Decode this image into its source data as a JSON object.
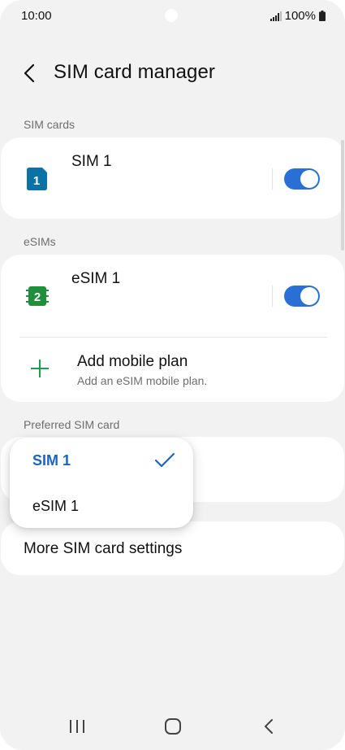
{
  "status_bar": {
    "time": "10:00",
    "battery": "100%"
  },
  "header": {
    "title": "SIM card manager",
    "back_icon": "chevron-left-icon"
  },
  "sim_cards": {
    "section_label": "SIM cards",
    "items": [
      {
        "label": "SIM 1",
        "icon": "sim-1-icon",
        "icon_number": "1",
        "icon_color": "#0b72a8",
        "enabled": true
      }
    ]
  },
  "esims": {
    "section_label": "eSIMs",
    "items": [
      {
        "label": "eSIM 1",
        "icon": "esim-2-icon",
        "icon_number": "2",
        "icon_color": "#1e8f3a",
        "enabled": true
      }
    ],
    "add_plan": {
      "title": "Add mobile plan",
      "subtitle": "Add an eSIM mobile plan."
    }
  },
  "preferred": {
    "section_label": "Preferred SIM card",
    "dropdown": {
      "options": [
        {
          "label": "SIM 1",
          "selected": true
        },
        {
          "label": "eSIM 1",
          "selected": false
        }
      ]
    }
  },
  "more": {
    "label": "More SIM card settings"
  },
  "colors": {
    "accent": "#2a6fd6",
    "selected_text": "#1a64c8",
    "background": "#f2f2f2"
  }
}
